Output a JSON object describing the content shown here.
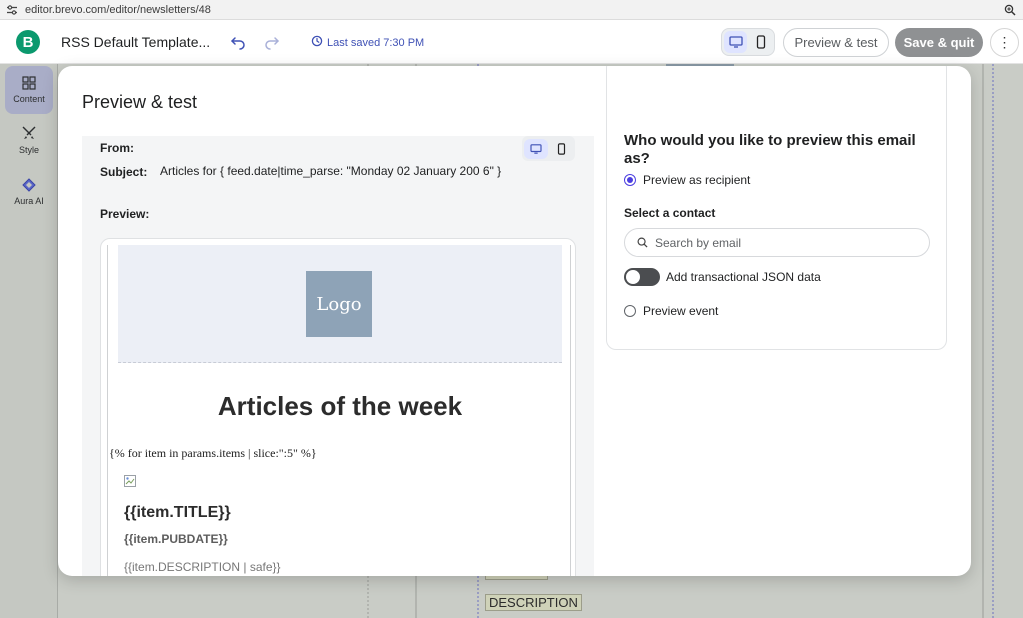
{
  "browser": {
    "url": "editor.brevo.com/editor/newsletters/48"
  },
  "topbar": {
    "brand_letter": "B",
    "title": "RSS Default Template...",
    "last_saved": "Last saved 7:30 PM",
    "preview_test_label": "Preview & test",
    "save_quit_label": "Save & quit",
    "more_label": "⋮"
  },
  "rail": {
    "items": [
      {
        "label": "Content",
        "icon": "grid-icon",
        "active": true
      },
      {
        "label": "Style",
        "icon": "brush-icon",
        "active": false
      },
      {
        "label": "Aura AI",
        "icon": "diamond-icon",
        "active": false
      }
    ]
  },
  "background": {
    "tag_label": "DESCRIPTION"
  },
  "modal": {
    "title": "Preview & test",
    "from_label": "From:",
    "subject_label": "Subject:",
    "subject_value": "Articles for { feed.date|time_parse: \"Monday 02 January 200 6\" }",
    "preview_label": "Preview:",
    "email": {
      "logo_text": "Logo",
      "heading": "Articles of the week",
      "loop_code": "{% for item in params.items | slice:\":5\" %}",
      "item_title": "{{item.TITLE}}",
      "item_pubdate": "{{item.PUBDATE}}",
      "item_description": "{{item.DESCRIPTION | safe}}"
    },
    "options": {
      "question": "Who would you like to preview this email as?",
      "preview_as_recipient": "Preview as recipient",
      "select_contact_label": "Select a contact",
      "search_placeholder": "Search by email",
      "json_toggle_label": "Add transactional JSON data",
      "preview_event": "Preview event"
    }
  },
  "colors": {
    "brand": "#0b996e",
    "accent": "#4b3ee0",
    "save_button": "#8f9193"
  }
}
